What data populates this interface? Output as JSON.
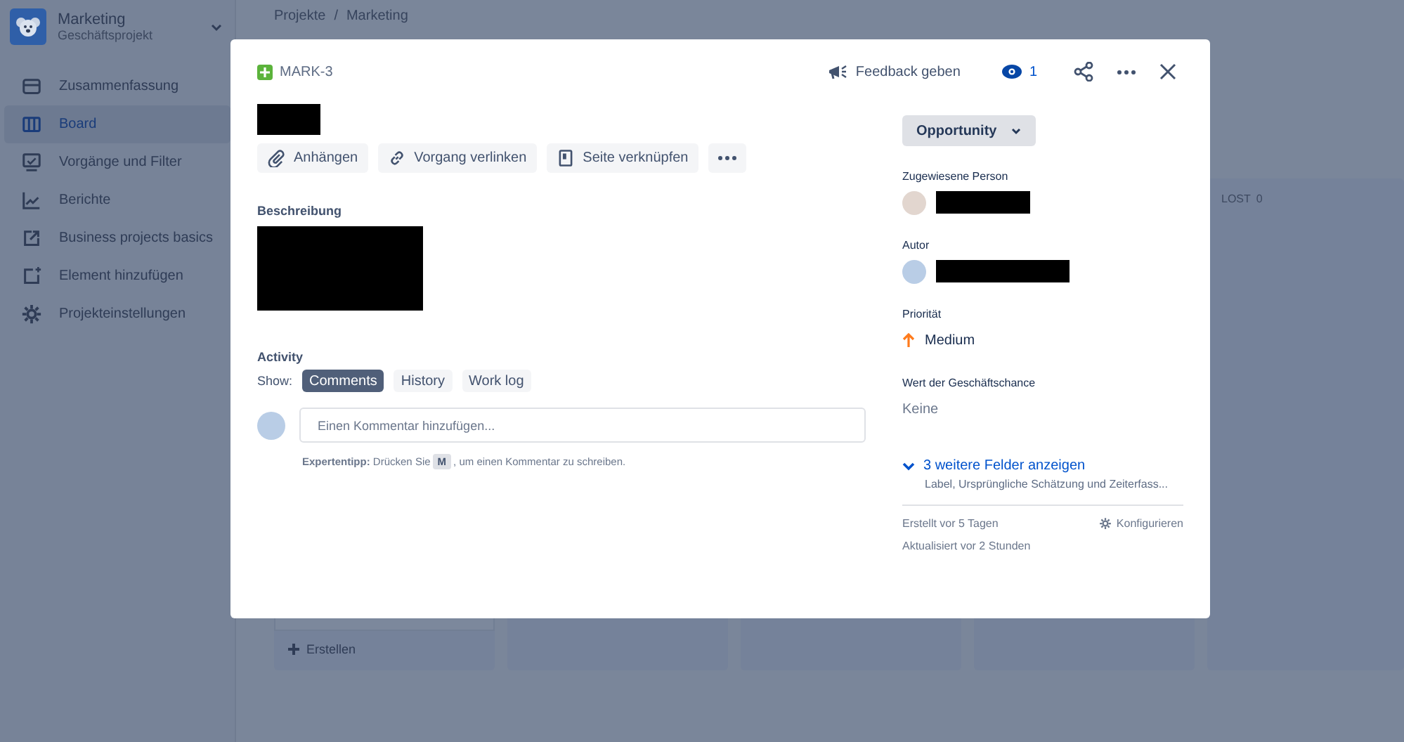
{
  "sidebar": {
    "project_name": "Marketing",
    "project_type": "Geschäftsprojekt",
    "items": [
      {
        "label": "Zusammenfassung",
        "selected": false
      },
      {
        "label": "Board",
        "selected": true
      },
      {
        "label": "Vorgänge und Filter",
        "selected": false
      },
      {
        "label": "Berichte",
        "selected": false
      },
      {
        "label": "Business projects basics",
        "selected": false
      },
      {
        "label": "Element hinzufügen",
        "selected": false
      },
      {
        "label": "Projekteinstellungen",
        "selected": false
      }
    ]
  },
  "breadcrumbs": [
    "Projekte",
    "Marketing"
  ],
  "breadcrumb_separator": "/",
  "board": {
    "columns": [
      {
        "kind": "with_card",
        "create_label": "Erstellen"
      },
      {},
      {},
      {},
      {
        "title": "LOST",
        "count": "0"
      }
    ]
  },
  "issue": {
    "key": "MARK-3",
    "feedback": "Feedback geben",
    "watchers": "1",
    "actions": [
      "Anhängen",
      "Vorgang verlinken",
      "Seite verknüpfen"
    ],
    "description_label": "Beschreibung",
    "activity": {
      "title": "Activity",
      "show_label": "Show:",
      "filters": [
        {
          "label": "Comments",
          "selected": true
        },
        {
          "label": "History",
          "selected": false
        },
        {
          "label": "Work log",
          "selected": false
        }
      ],
      "comment_placeholder": "Einen Kommentar hinzufügen...",
      "tip_before": "**Expertentipp:** Drücken Sie",
      "tip_key": "M",
      "tip_after": ", um einen Kommentar zu schreiben."
    },
    "status": "Opportunity",
    "fields": [
      {
        "kind": "person",
        "label": "Zugewiesene Person"
      },
      {
        "kind": "person",
        "label": "Autor"
      },
      {
        "kind": "priority",
        "label": "Priorität",
        "value": "Medium"
      },
      {
        "kind": "text",
        "label": "Wert der Geschäftschance",
        "value": "Keine"
      }
    ],
    "more_fields": {
      "label": "3 weitere Felder anzeigen",
      "hint": "Label, Ursprüngliche Schätzung und Zeiterfass..."
    },
    "created": "Erstellt vor 5 Tagen",
    "updated": "Aktualisiert vor 2 Stunden",
    "configure": "Konfigurieren"
  }
}
